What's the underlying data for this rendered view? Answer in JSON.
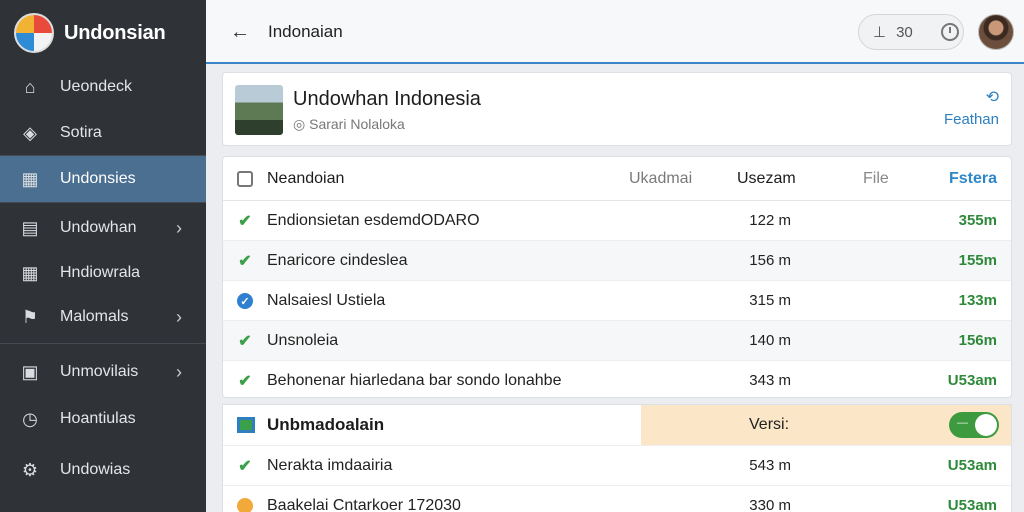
{
  "app": {
    "name": "Undonsian"
  },
  "sidebar": {
    "items": [
      {
        "label": "Ueondeck",
        "icon": "house-icon"
      },
      {
        "label": "Sotira",
        "icon": "tag-icon"
      },
      {
        "label": "Undonsies",
        "icon": "chart-icon",
        "active": true
      },
      {
        "label": "Undowhan",
        "icon": "document-icon",
        "chevron": true
      },
      {
        "label": "Hndiowrala",
        "icon": "grid-icon"
      },
      {
        "label": "Malomals",
        "icon": "flag-icon",
        "chevron": true
      },
      {
        "label": "Unmovilais",
        "icon": "calendar-icon",
        "chevron": true
      },
      {
        "label": "Hoantiulas",
        "icon": "clock-icon"
      },
      {
        "label": "Undowias",
        "icon": "gear-icon"
      }
    ]
  },
  "header": {
    "title": "Indonaian",
    "pill_count": "30"
  },
  "info": {
    "title": "Undowhan Indonesia",
    "subtitle": "Sarari Nolaloka",
    "action": "Feathan"
  },
  "table": {
    "columns": [
      "Neandoian",
      "Ukadmai",
      "Usezam",
      "File",
      "Fstera"
    ],
    "rows": [
      {
        "status": "ok",
        "name": "Endionsietan esdemdODARO",
        "size": "122 m",
        "value": "355m"
      },
      {
        "status": "ok",
        "name": "Enaricore cindeslea",
        "size": "156 m",
        "value": "155m"
      },
      {
        "status": "info",
        "name": "Nalsaiesl Ustiela",
        "size": "315 m",
        "value": "133m"
      },
      {
        "status": "ok",
        "name": "Unsnoleia",
        "size": "140 m",
        "value": "156m"
      },
      {
        "status": "ok",
        "name": "Behonenar hiarledana bar sondo lonahbe",
        "size": "343 m",
        "value": "U53am"
      }
    ]
  },
  "lower": {
    "title": "Unbmadoalain",
    "version_label": "Versi:",
    "rows": [
      {
        "status": "ok",
        "name": "Nerakta imdaairia",
        "size": "543 m",
        "value": "U53am"
      },
      {
        "status": "warn",
        "name": "Baakelai Cntarkoer 172030",
        "size": "330 m",
        "value": "U53am"
      }
    ]
  },
  "colors": {
    "sidebar_bg": "#2f3338",
    "active_item": "#4a6f91",
    "accent": "#2e7fbf",
    "success": "#3aa04a",
    "highlight": "#fbe6c7"
  }
}
